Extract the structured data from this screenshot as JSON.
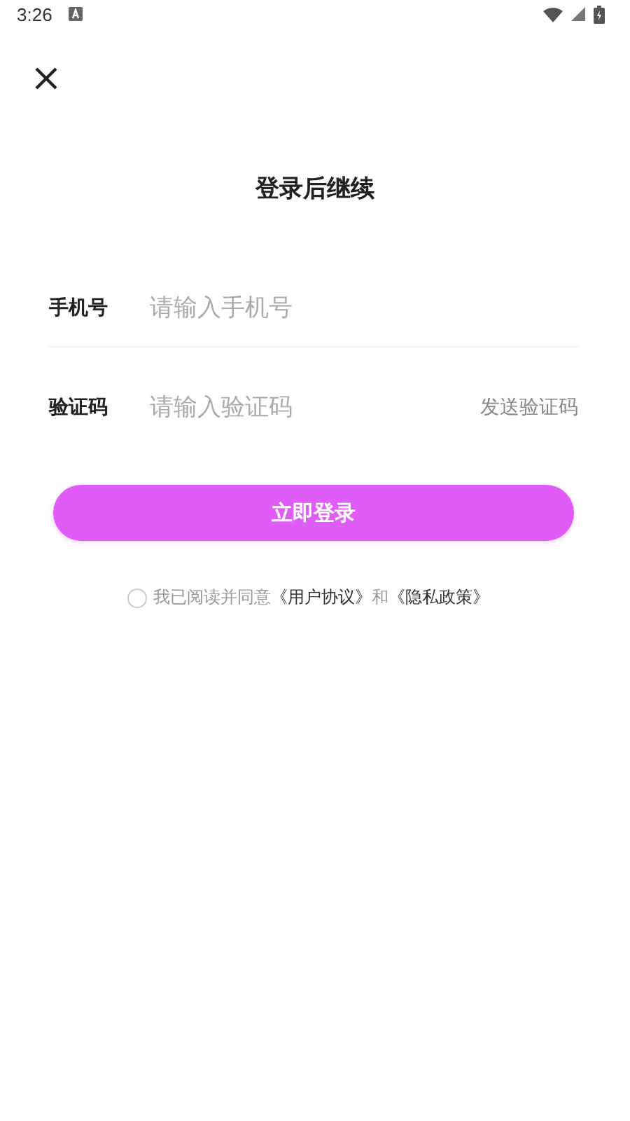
{
  "status_bar": {
    "time": "3:26"
  },
  "title": "登录后继续",
  "fields": [
    {
      "kind": "phone",
      "label": "手机号",
      "placeholder": "请输入手机号"
    },
    {
      "kind": "code",
      "label": "验证码",
      "placeholder": "请输入验证码",
      "action": "发送验证码"
    }
  ],
  "login_button": "立即登录",
  "agreement": {
    "checked": false,
    "prefix": "我已阅读并同意",
    "link_1": "《用户协议》",
    "joiner": "和",
    "link_2": "《隐私政策》"
  }
}
